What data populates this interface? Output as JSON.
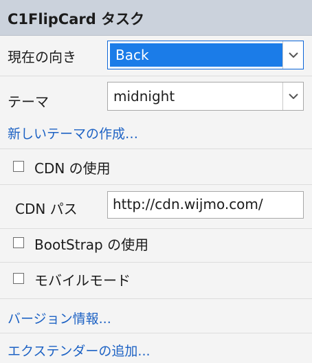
{
  "header": {
    "title": "C1FlipCard タスク"
  },
  "orientation": {
    "label": "現在の向き",
    "value": "Back"
  },
  "theme": {
    "label": "テーマ",
    "value": "midnight"
  },
  "create_theme_link": "新しいテーマの作成…",
  "cdn": {
    "use_label": "CDN の使用",
    "use_checked": false,
    "path_label": "CDN パス",
    "path_value": "http://cdn.wijmo.com/"
  },
  "bootstrap": {
    "label": "BootStrap の使用",
    "checked": false
  },
  "mobile": {
    "label": "モバイルモード",
    "checked": false
  },
  "version_link": "バージョン情報...",
  "add_extender_link": "エクステンダーの追加...",
  "colors": {
    "header_bg": "#cbd2dc",
    "link": "#1d62c4",
    "selection": "#1b7ce8"
  }
}
